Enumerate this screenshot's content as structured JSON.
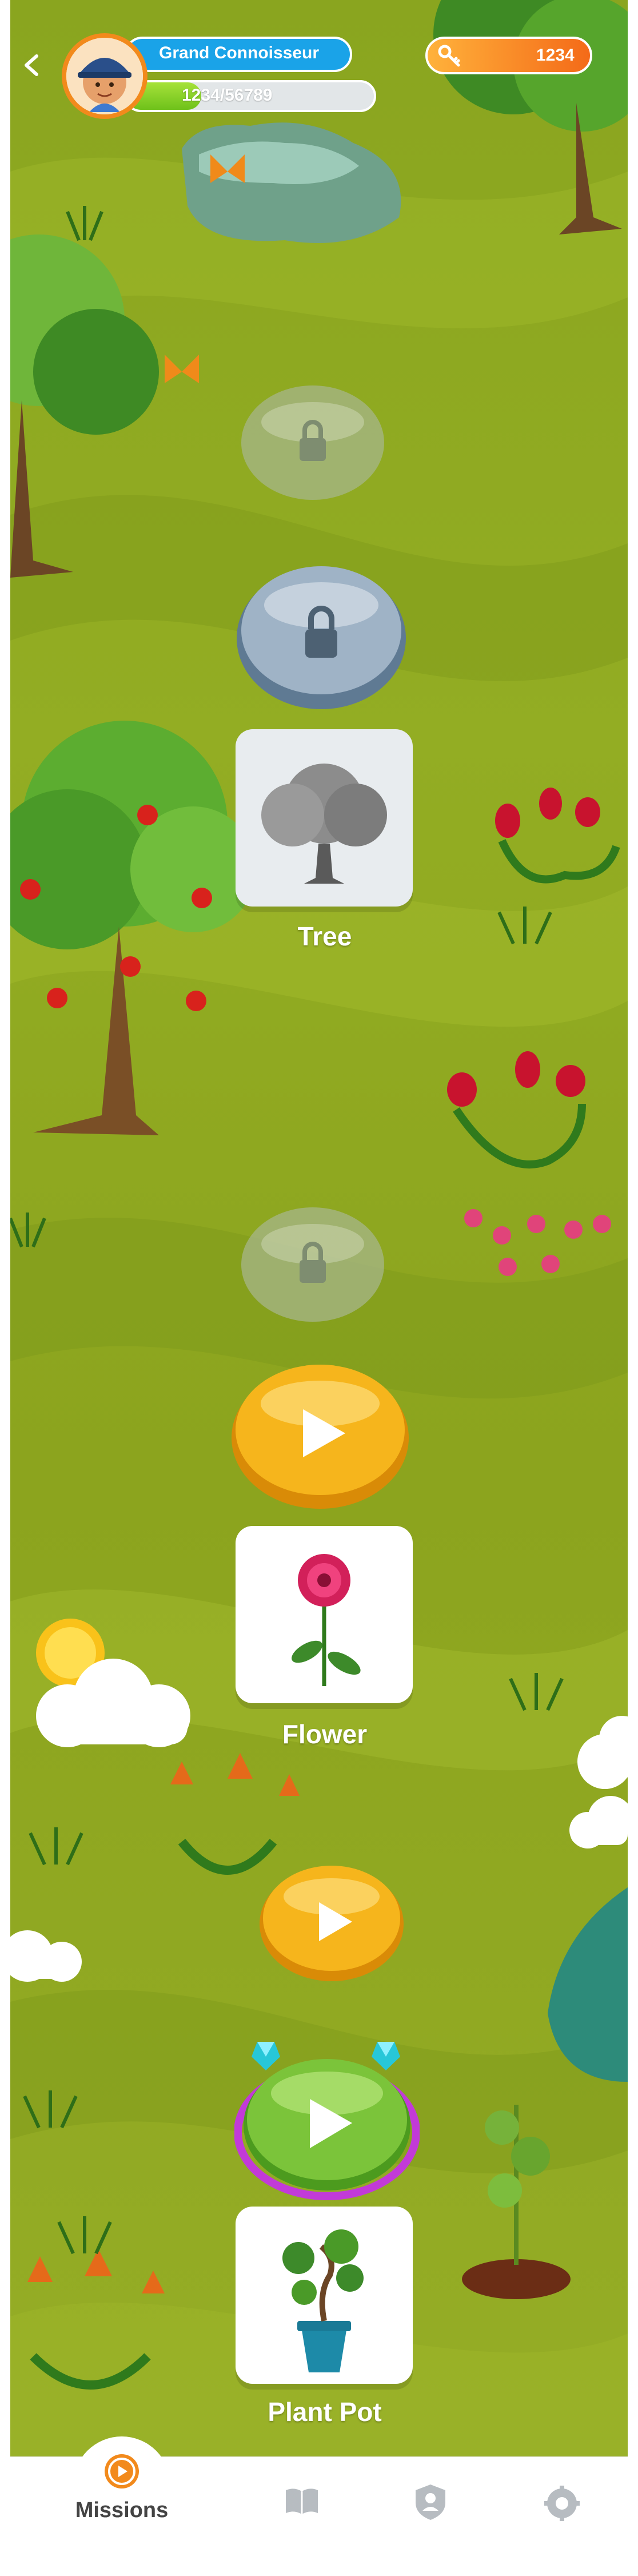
{
  "hud": {
    "back_icon": "back-chevron-icon",
    "rank_title": "Grand Connoisseur",
    "xp_text": "1234/56789",
    "xp_progress": 0.3,
    "key_icon": "key-icon",
    "keys_count": "1234"
  },
  "levels": [
    {
      "state": "locked",
      "style": "faded"
    },
    {
      "state": "locked",
      "style": "active"
    },
    {
      "state": "reward",
      "reward_name": "Tree"
    },
    {
      "state": "locked",
      "style": "faded"
    },
    {
      "state": "play",
      "style": "gold"
    },
    {
      "state": "reward",
      "reward_name": "Flower"
    },
    {
      "state": "play",
      "style": "gold-small"
    },
    {
      "state": "play",
      "style": "green-current",
      "badges": 2
    },
    {
      "state": "reward",
      "reward_name": "Plant Pot"
    }
  ],
  "nav": {
    "items": [
      {
        "label": "Missions",
        "icon": "missions-target-icon",
        "active": true
      },
      {
        "label": "",
        "icon": "book-icon"
      },
      {
        "label": "",
        "icon": "profile-shield-icon"
      },
      {
        "label": "",
        "icon": "settings-gear-icon"
      }
    ]
  },
  "colors": {
    "grass": "#8fa921",
    "rank_pill": "#1aa3e8",
    "key_pill": "#f46a18",
    "xp_fill": "#6ec11a",
    "gold_button": "#f6b51c",
    "green_button": "#7bc43a",
    "current_ring": "#c23ad8"
  }
}
